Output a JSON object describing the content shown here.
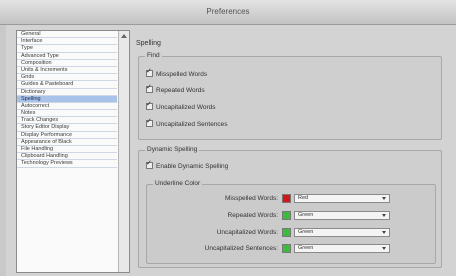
{
  "window": {
    "title": "Preferences"
  },
  "sidebar": {
    "items": [
      "General",
      "Interface",
      "Type",
      "Advanced Type",
      "Composition",
      "Units & Increments",
      "Grids",
      "Guides & Pasteboard",
      "Dictionary",
      "Spelling",
      "Autocorrect",
      "Notes",
      "Track Changes",
      "Story Editor Display",
      "Display Performance",
      "Appearance of Black",
      "File Handling",
      "Clipboard Handling",
      "Technology Previews"
    ],
    "selected": "Spelling"
  },
  "main": {
    "section_title": "Spelling",
    "find": {
      "label": "Find",
      "options": [
        {
          "label": "Misspelled Words",
          "checked": true
        },
        {
          "label": "Repeated Words",
          "checked": true
        },
        {
          "label": "Uncapitalized Words",
          "checked": true
        },
        {
          "label": "Uncapitalized Sentences",
          "checked": true
        }
      ]
    },
    "dynamic": {
      "label": "Dynamic Spelling",
      "enable_label": "Enable Dynamic Spelling",
      "enable_checked": true,
      "underline": {
        "label": "Underline Color",
        "rows": [
          {
            "label": "Misspelled Words:",
            "value": "Red",
            "color": "#d01818"
          },
          {
            "label": "Repeated Words:",
            "value": "Green",
            "color": "#3dbb3d"
          },
          {
            "label": "Uncapitalized Words:",
            "value": "Green",
            "color": "#3dbb3d"
          },
          {
            "label": "Uncapitalized Sentences:",
            "value": "Green",
            "color": "#3dbb3d"
          }
        ]
      }
    }
  }
}
